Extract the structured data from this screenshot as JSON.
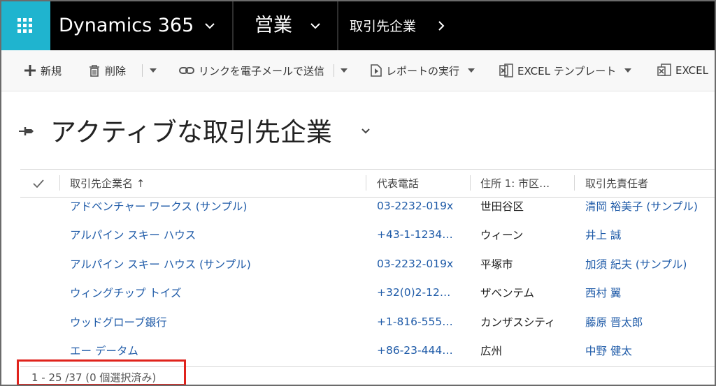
{
  "nav": {
    "product": "Dynamics 365",
    "area": "営業",
    "breadcrumb": "取引先企業"
  },
  "commands": {
    "new": "新規",
    "delete": "削除",
    "email_link": "リンクを電子メールで送信",
    "run_report": "レポートの実行",
    "excel_template": "EXCEL テンプレート",
    "export_excel": "EXCEL"
  },
  "view": {
    "title": "アクティブな取引先企業"
  },
  "grid": {
    "columns": [
      "取引先企業名 ↑",
      "代表電話",
      "住所 1: 市区…",
      "取引先責任者"
    ],
    "rows": [
      {
        "name": "アドベンチャー ワークス (サンプル)",
        "phone": "03-2232-019x",
        "city": "世田谷区",
        "contact": "清岡 裕美子 (サンプル)"
      },
      {
        "name": "アルパイン スキー ハウス",
        "phone": "+43-1-1234…",
        "city": "ウィーン",
        "contact": "井上 誠"
      },
      {
        "name": "アルパイン スキー ハウス (サンプル)",
        "phone": "03-2232-019x",
        "city": "平塚市",
        "contact": "加須 紀夫 (サンプル)"
      },
      {
        "name": "ウィングチップ トイズ",
        "phone": "+32(0)2-12…",
        "city": "ザベンテム",
        "contact": "西村 翼"
      },
      {
        "name": "ウッドグローブ銀行",
        "phone": "+1-816-555…",
        "city": "カンザスシティ",
        "contact": "藤原 晋太郎"
      },
      {
        "name": "エー データム",
        "phone": "+86-23-444…",
        "city": "広州",
        "contact": "中野 健太"
      }
    ]
  },
  "footer": {
    "record_count": "1 - 25 /37 (0 個選択済み)"
  },
  "colors": {
    "launcher": "#1fb4cf",
    "link": "#1f5ba8",
    "highlight": "#e0231c"
  }
}
